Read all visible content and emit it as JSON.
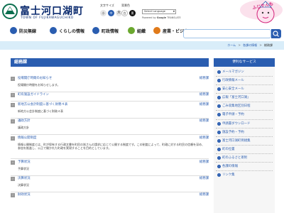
{
  "header": {
    "title": "富士河口湖町",
    "subtitle": "TOWN OF FUJIKAWAGUCHIKO",
    "font_size_label": "文字サイズ",
    "font_size": {
      "small": "小",
      "standard": "中",
      "large": "大"
    },
    "bg_color_label": "背景色",
    "bg_color": {
      "white": "白",
      "black": "黒"
    },
    "language_select": "Select Language",
    "powered_by": "Powered by",
    "google": "Google",
    "translate": "TRANSLATE",
    "mascot_label": "ふじやんも"
  },
  "nav": {
    "items": [
      {
        "label": "防災無線",
        "icon": "radio-icon",
        "color": "#2a5db0"
      },
      {
        "label": "くらしの情報",
        "icon": "home-icon",
        "color": "#2a5db0"
      },
      {
        "label": "町政情報",
        "icon": "building-icon",
        "color": "#2a5db0"
      },
      {
        "label": "組織",
        "icon": "org-icon",
        "color": "#6ba82f"
      },
      {
        "label": "産業・ビジネ",
        "icon": "industry-icon",
        "color": "#e07a1a"
      }
    ]
  },
  "breadcrumb": {
    "home": "ホーム",
    "section": "各課の情報",
    "current": "総務課",
    "separator": ">"
  },
  "main": {
    "title": "総務課",
    "entries": [
      {
        "link": "役場開庁時間のお知らせ",
        "dept": "総務課",
        "desc": "役場開庁時間をお知らせします。"
      },
      {
        "link": "町有施設ガイドライン",
        "dept": "総務課",
        "desc": ""
      },
      {
        "link": "新地方公会計制度に基づく財務４表",
        "dept": "総務課",
        "desc": "新地方公会計制度に基づく財務４表"
      },
      {
        "link": "議政方針",
        "dept": "総務課",
        "desc": "議政方針"
      },
      {
        "link": "情報公開制度",
        "dept": "総務課",
        "desc": "情報公開制度とは、町が保有する行政文書を町民の皆さんの請求に応じて公開する制度です。この制度によって、町政に対する町民の信頼を深め、参加を推進し、公正で開かれた町政を実現することを目的としています。"
      },
      {
        "link": "予算状況",
        "dept": "総務課",
        "desc": "予算状況"
      },
      {
        "link": "決算状況",
        "dept": "総務課",
        "desc": "決算状況"
      },
      {
        "link": "財政状況",
        "dept": "総務課",
        "desc": ""
      }
    ]
  },
  "sidebar": {
    "title": "便利なサービス",
    "items": [
      "メールマガジン",
      "行政情報メール",
      "安心安全メール",
      "広報「富士河口湖」",
      "ごみ収集地区別日程",
      "電子申請・予約",
      "申請書ダウンロード",
      "施設予約・予約",
      "富士河口湖町例規集",
      "町の位置",
      "町のふるさと寄附",
      "各課の情報",
      "リンク集"
    ]
  },
  "colors": {
    "accent": "#2a5db0",
    "breadcrumb_bg": "#d9edf9",
    "sidebar_bg": "#f6f6f6"
  }
}
